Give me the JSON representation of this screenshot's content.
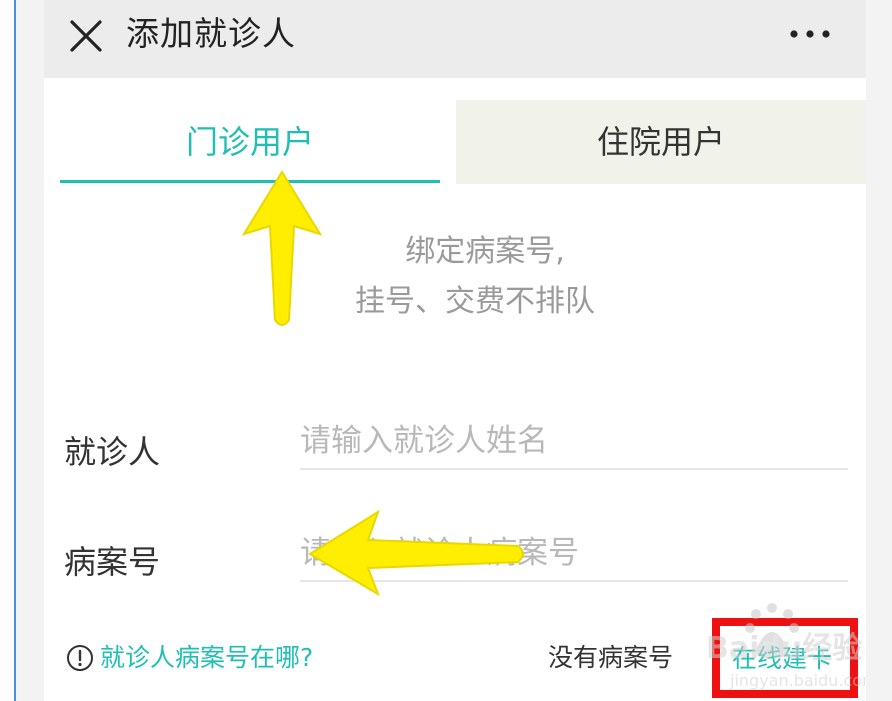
{
  "header": {
    "title": "添加就诊人",
    "close_icon": "close-icon",
    "more_icon": "more-icon"
  },
  "tabs": [
    {
      "label": "门诊用户",
      "active": true
    },
    {
      "label": "住院用户",
      "active": false
    }
  ],
  "promo": {
    "line1": "绑定病案号,",
    "line2": "挂号、交费不排队"
  },
  "form": {
    "patient": {
      "label": "就诊人",
      "placeholder": "请输入就诊人姓名",
      "value": ""
    },
    "record": {
      "label": "病案号",
      "placeholder": "请输入就诊人病案号",
      "value": ""
    }
  },
  "footer": {
    "help_link": "就诊人病案号在哪?",
    "no_record": "没有病案号",
    "create_card": "在线建卡"
  },
  "watermark": {
    "brand": "Baidu经验",
    "url": "jingyan.baidu.com"
  },
  "colors": {
    "accent": "#1fbfb3",
    "highlight_box": "#ee1111",
    "arrow": "#ffee00",
    "header_bg": "#ececec",
    "inactive_tab_bg": "#f1f3ea"
  }
}
